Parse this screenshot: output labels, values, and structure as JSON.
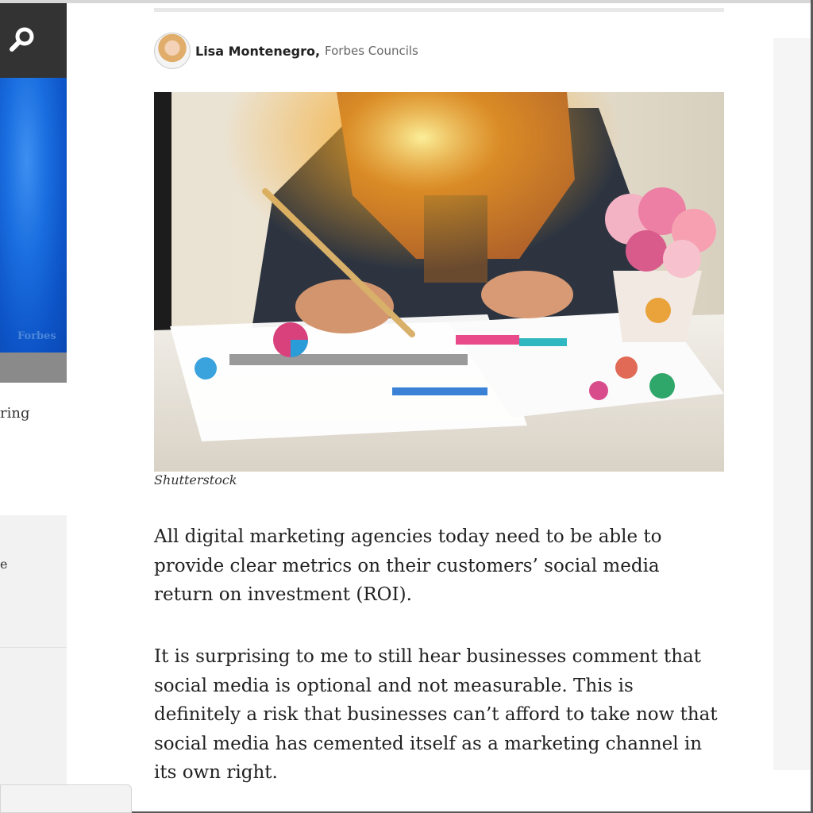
{
  "sidebar": {
    "search_icon": "search-icon",
    "promo_logo": "Forbes",
    "truncated_text_1": "ring",
    "truncated_text_2": "e"
  },
  "article": {
    "author": "Lisa Montenegro,",
    "council": "Forbes Councils",
    "image_caption": "Shutterstock",
    "paragraphs": [
      "All digital marketing agencies today need to be able to provide clear metrics on their customers’ social media return on investment (ROI).",
      "It is surprising to me to still hear businesses comment that social media is optional and not measurable. This is definitely a risk that businesses can’t afford to take now that social media has cemented itself as a marketing channel in its own right."
    ]
  },
  "colors": {
    "search_bg": "#333333",
    "promo_blue": "#1b6fe0",
    "text": "#222222"
  }
}
